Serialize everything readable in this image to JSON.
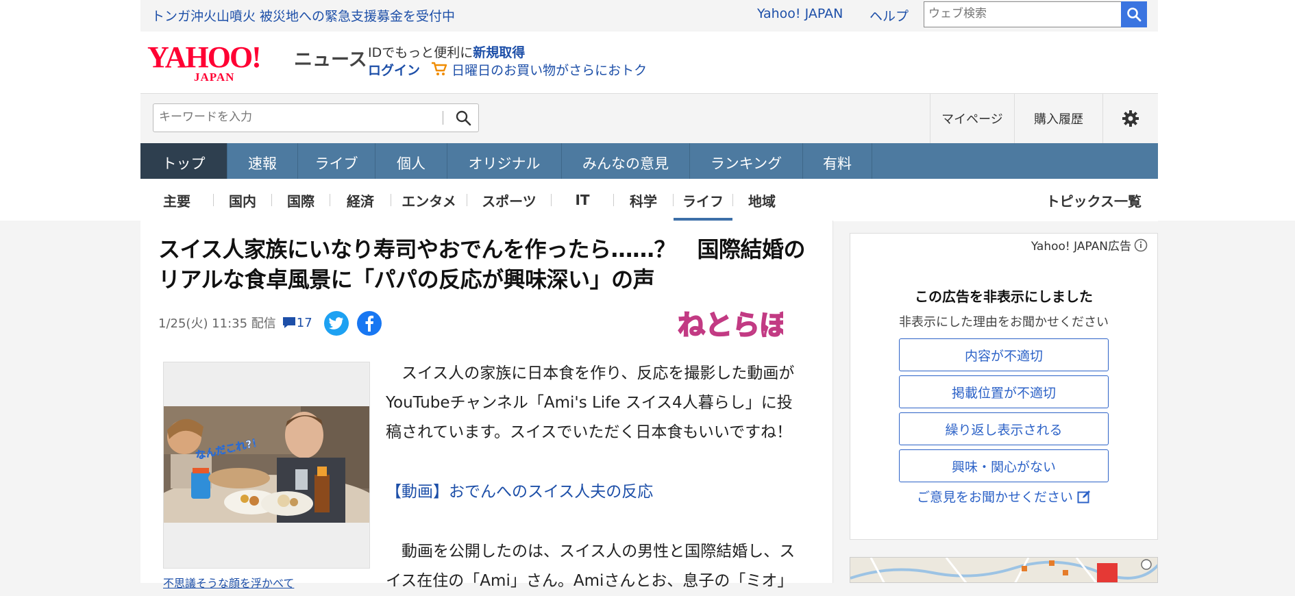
{
  "topbar": {
    "notice": "トンガ沖火山噴火 被災地への緊急支援募金を受付中",
    "yahoo_japan_link": "Yahoo! JAPAN",
    "help_link": "ヘルプ",
    "web_search_placeholder": "ウェブ検索"
  },
  "header": {
    "logo_text": "YAHOO! JAPAN",
    "site_name": "ニュース",
    "id_prompt": "IDでもっと便利に",
    "signup": "新規取得",
    "login": "ログイン",
    "promo": "日曜日のお買い物がさらにおトク"
  },
  "search": {
    "placeholder": "キーワードを入力",
    "mypage": "マイページ",
    "history": "購入履歴"
  },
  "main_nav": [
    "トップ",
    "速報",
    "ライブ",
    "個人",
    "オリジナル",
    "みんなの意見",
    "ランキング",
    "有料"
  ],
  "sub_nav": [
    "主要",
    "国内",
    "国際",
    "経済",
    "エンタメ",
    "スポーツ",
    "IT",
    "科学",
    "ライフ",
    "地域"
  ],
  "sub_nav_active": "ライフ",
  "topics_link": "トピックス一覧",
  "article": {
    "title_line1": "スイス人家族にいなり寿司やおでんを作ったら……？　国際結婚の",
    "title_line2": "リアルな食卓風景に「パパの反応が興味深い」の声",
    "date": "1/25(火) 11:35 配信",
    "comment_count": "17",
    "source_logo": "ねとらぼ",
    "image_overlay_text": "なんだこれ?！",
    "caption": "不思議そうな顔を浮かべて",
    "para1_l1": "　スイス人の家族に日本食を作り、反応を撮影した動画が",
    "para1_l2": "YouTubeチャンネル「Ami's Life スイス4人暮らし」に投",
    "para1_l3": "稿されています。スイスでいただく日本食もいいですね！",
    "video_link": "【動画】おでんへのスイス人夫の反応",
    "para2_l1": "　動画を公開したのは、スイス人の男性と国際結婚し、ス",
    "para2_l2": "イス在住の「Ami」さん。Amiさんとお、息子の「ミオ」"
  },
  "ad": {
    "label": "Yahoo! JAPAN広告",
    "title": "この広告を非表示にしました",
    "subtitle": "非表示にした理由をお聞かせください",
    "reasons": [
      "内容が不適切",
      "掲載位置が不適切",
      "繰り返し表示される",
      "興味・関心がない"
    ],
    "feedback": "ご意見をお聞かせください"
  },
  "colors": {
    "nav_bg": "#4d7aa0",
    "nav_active": "#2e3f4f",
    "link": "#1d4fa8",
    "accent_blue": "#3a74e0",
    "brand_red": "#ff0033"
  }
}
